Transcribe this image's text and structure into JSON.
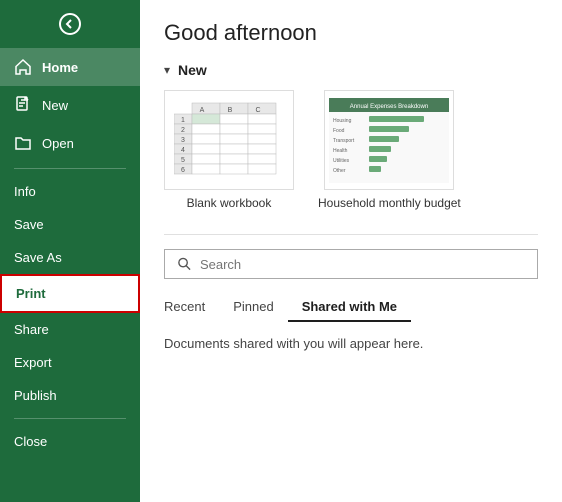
{
  "sidebar": {
    "back_label": "Back",
    "items": [
      {
        "id": "home",
        "label": "Home",
        "icon": "home-icon"
      },
      {
        "id": "new",
        "label": "New",
        "icon": "new-icon"
      },
      {
        "id": "open",
        "label": "Open",
        "icon": "open-icon"
      }
    ],
    "text_items": [
      {
        "id": "info",
        "label": "Info"
      },
      {
        "id": "save",
        "label": "Save"
      },
      {
        "id": "save-as",
        "label": "Save As"
      },
      {
        "id": "print",
        "label": "Print"
      },
      {
        "id": "share",
        "label": "Share"
      },
      {
        "id": "export",
        "label": "Export"
      },
      {
        "id": "publish",
        "label": "Publish"
      },
      {
        "id": "close",
        "label": "Close"
      }
    ]
  },
  "main": {
    "greeting": "Good afternoon",
    "new_section": {
      "label": "New",
      "chevron": "▾"
    },
    "templates": [
      {
        "id": "blank",
        "label": "Blank workbook"
      },
      {
        "id": "budget",
        "label": "Household monthly budget"
      }
    ],
    "search": {
      "placeholder": "Search",
      "icon": "search-icon"
    },
    "tabs": [
      {
        "id": "recent",
        "label": "Recent"
      },
      {
        "id": "pinned",
        "label": "Pinned"
      },
      {
        "id": "shared",
        "label": "Shared with Me",
        "active": true
      }
    ],
    "shared_message": "Documents shared with you will appear here."
  }
}
